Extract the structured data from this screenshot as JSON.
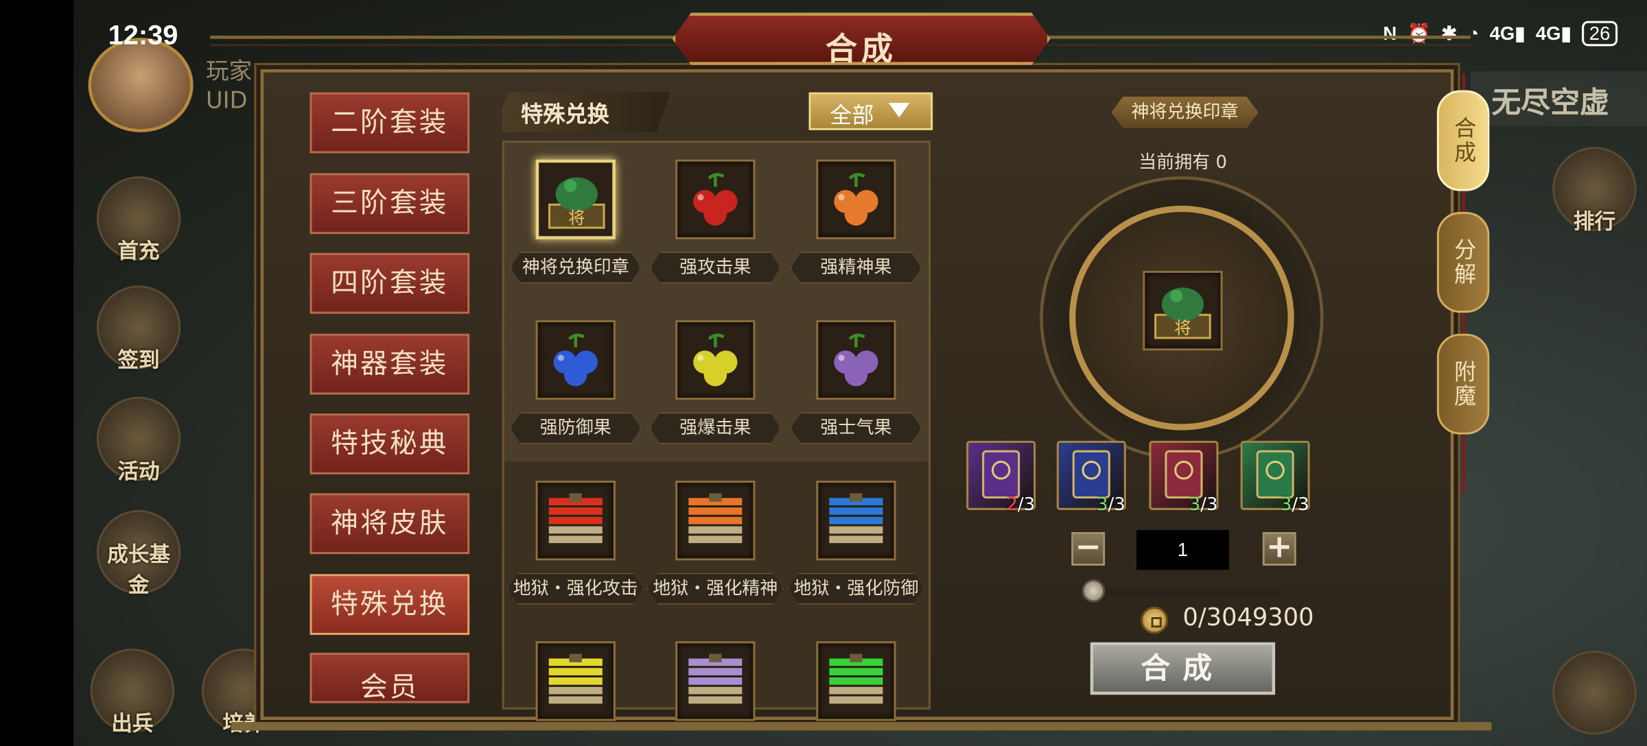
{
  "status_bar": {
    "time": "12:39",
    "icons": [
      "nfc-icon",
      "alarm-icon",
      "bluetooth-icon",
      "wifi-icon",
      "signal-4g-1-icon",
      "signal-4g-2-icon"
    ],
    "net1": "4G",
    "net2": "4G",
    "battery": "26"
  },
  "background": {
    "player_name_fragment": "玩家",
    "uid_label": "UID",
    "hud_left": [
      "首充",
      "签到",
      "活动",
      "成长基金",
      "出兵",
      "培养"
    ],
    "hud_right": [
      "排行"
    ],
    "right_nav_title": "无尽空虚"
  },
  "title": "合成",
  "left_tabs": [
    "二阶套装",
    "三阶套装",
    "四阶套装",
    "神器套装",
    "特技秘典",
    "神将皮肤",
    "特殊兑换",
    "会员"
  ],
  "active_tab": "特殊兑换",
  "middle": {
    "header": "特殊兑换",
    "filter": "全部",
    "items": [
      {
        "name": "神将兑换印章",
        "icon": "jade-seal-icon",
        "color": "#2f7a3c",
        "selected": true
      },
      {
        "name": "强攻击果",
        "icon": "red-fruit-icon",
        "color": "#c8251f"
      },
      {
        "name": "强精神果",
        "icon": "orange-fruit-icon",
        "color": "#e57a2c"
      },
      {
        "name": "强防御果",
        "icon": "blue-fruit-icon",
        "color": "#2f5bd6"
      },
      {
        "name": "强爆击果",
        "icon": "yellow-fruit-icon",
        "color": "#d8d02a"
      },
      {
        "name": "强士气果",
        "icon": "purple-fruit-icon",
        "color": "#8a62b8"
      },
      {
        "name": "地狱・强化攻击",
        "icon": "red-book-stack-icon",
        "color": "#d8321f"
      },
      {
        "name": "地狱・强化精神",
        "icon": "orange-book-stack-icon",
        "color": "#e8762a"
      },
      {
        "name": "地狱・强化防御",
        "icon": "blue-book-stack-icon",
        "color": "#2b78d8"
      },
      {
        "name": "",
        "icon": "yellow-book-stack-icon",
        "color": "#e2d72e"
      },
      {
        "name": "",
        "icon": "purple-book-stack-icon",
        "color": "#a98fd0"
      },
      {
        "name": "",
        "icon": "green-book-stack-icon",
        "color": "#37d23a"
      }
    ]
  },
  "detail": {
    "item_title": "神将兑换印章",
    "owned_label": "当前拥有",
    "owned_value": "0",
    "materials": [
      {
        "icon": "purple-scroll-icon",
        "color": "#5a2f8a",
        "have": "2",
        "need": "/3",
        "ok": false
      },
      {
        "icon": "blue-scroll-icon",
        "color": "#2a3c8e",
        "have": "3",
        "need": "/3",
        "ok": true
      },
      {
        "icon": "red-scroll-icon",
        "color": "#8a2a3c",
        "have": "3",
        "need": "/3",
        "ok": true
      },
      {
        "icon": "green-scroll-icon",
        "color": "#2a7a48",
        "have": "3",
        "need": "/3",
        "ok": true
      }
    ],
    "minus": "−",
    "plus": "+",
    "quantity": "1",
    "slider_value": 0,
    "cost": "0/3049300",
    "combine_button": "合成"
  },
  "side_tabs": [
    {
      "label": "合成",
      "active": true
    },
    {
      "label": "分解",
      "active": false
    },
    {
      "label": "附魔",
      "active": false
    }
  ]
}
